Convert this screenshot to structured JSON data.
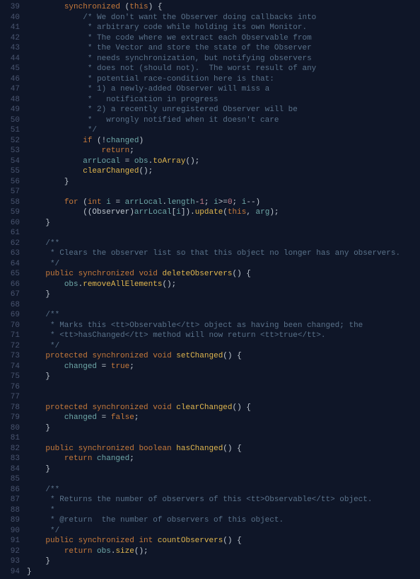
{
  "lines": [
    {
      "n": 39,
      "indent": 8,
      "t": [
        {
          "c": "kw",
          "s": "synchronized"
        },
        {
          "c": "pl",
          "s": " ("
        },
        {
          "c": "kw",
          "s": "this"
        },
        {
          "c": "pl",
          "s": ") {"
        }
      ]
    },
    {
      "n": 40,
      "indent": 12,
      "t": [
        {
          "c": "cmt",
          "s": "/* We don't want the Observer doing callbacks into"
        }
      ]
    },
    {
      "n": 41,
      "indent": 12,
      "t": [
        {
          "c": "cmt",
          "s": " * arbitrary code while holding its own Monitor."
        }
      ]
    },
    {
      "n": 42,
      "indent": 12,
      "t": [
        {
          "c": "cmt",
          "s": " * The code where we extract each Observable from"
        }
      ]
    },
    {
      "n": 43,
      "indent": 12,
      "t": [
        {
          "c": "cmt",
          "s": " * the Vector and store the state of the Observer"
        }
      ]
    },
    {
      "n": 44,
      "indent": 12,
      "t": [
        {
          "c": "cmt",
          "s": " * needs synchronization, but notifying observers"
        }
      ]
    },
    {
      "n": 45,
      "indent": 12,
      "t": [
        {
          "c": "cmt",
          "s": " * does not (should not).  The worst result of any"
        }
      ]
    },
    {
      "n": 46,
      "indent": 12,
      "t": [
        {
          "c": "cmt",
          "s": " * potential race-condition here is that:"
        }
      ]
    },
    {
      "n": 47,
      "indent": 12,
      "t": [
        {
          "c": "cmt",
          "s": " * 1) a newly-added Observer will miss a"
        }
      ]
    },
    {
      "n": 48,
      "indent": 12,
      "t": [
        {
          "c": "cmt",
          "s": " *   notification in progress"
        }
      ]
    },
    {
      "n": 49,
      "indent": 12,
      "t": [
        {
          "c": "cmt",
          "s": " * 2) a recently unregistered Observer will be"
        }
      ]
    },
    {
      "n": 50,
      "indent": 12,
      "t": [
        {
          "c": "cmt",
          "s": " *   wrongly notified when it doesn't care"
        }
      ]
    },
    {
      "n": 51,
      "indent": 12,
      "t": [
        {
          "c": "cmt",
          "s": " */"
        }
      ]
    },
    {
      "n": 52,
      "indent": 12,
      "t": [
        {
          "c": "kw",
          "s": "if"
        },
        {
          "c": "pl",
          "s": " (!"
        },
        {
          "c": "var",
          "s": "changed"
        },
        {
          "c": "pl",
          "s": ")"
        }
      ]
    },
    {
      "n": 53,
      "indent": 16,
      "t": [
        {
          "c": "kw",
          "s": "return"
        },
        {
          "c": "pl",
          "s": ";"
        }
      ]
    },
    {
      "n": 54,
      "indent": 12,
      "t": [
        {
          "c": "var",
          "s": "arrLocal"
        },
        {
          "c": "pl",
          "s": " = "
        },
        {
          "c": "var",
          "s": "obs"
        },
        {
          "c": "pl",
          "s": "."
        },
        {
          "c": "fn",
          "s": "toArray"
        },
        {
          "c": "pl",
          "s": "();"
        }
      ]
    },
    {
      "n": 55,
      "indent": 12,
      "t": [
        {
          "c": "fn",
          "s": "clearChanged"
        },
        {
          "c": "pl",
          "s": "();"
        }
      ]
    },
    {
      "n": 56,
      "indent": 8,
      "t": [
        {
          "c": "pl",
          "s": "}"
        }
      ]
    },
    {
      "n": 57,
      "indent": 0,
      "t": []
    },
    {
      "n": 58,
      "indent": 8,
      "t": [
        {
          "c": "kw",
          "s": "for"
        },
        {
          "c": "pl",
          "s": " ("
        },
        {
          "c": "kw",
          "s": "int"
        },
        {
          "c": "pl",
          "s": " "
        },
        {
          "c": "var",
          "s": "i"
        },
        {
          "c": "pl",
          "s": " = "
        },
        {
          "c": "var",
          "s": "arrLocal"
        },
        {
          "c": "pl",
          "s": "."
        },
        {
          "c": "var",
          "s": "length"
        },
        {
          "c": "pl",
          "s": "-"
        },
        {
          "c": "num",
          "s": "1"
        },
        {
          "c": "pl",
          "s": "; "
        },
        {
          "c": "var",
          "s": "i"
        },
        {
          "c": "pl",
          "s": ">="
        },
        {
          "c": "num",
          "s": "0"
        },
        {
          "c": "pl",
          "s": "; "
        },
        {
          "c": "var",
          "s": "i"
        },
        {
          "c": "pl",
          "s": "--)"
        }
      ]
    },
    {
      "n": 59,
      "indent": 12,
      "t": [
        {
          "c": "pl",
          "s": "(("
        },
        {
          "c": "type",
          "s": "Observer"
        },
        {
          "c": "pl",
          "s": ")"
        },
        {
          "c": "var",
          "s": "arrLocal"
        },
        {
          "c": "pl",
          "s": "["
        },
        {
          "c": "var",
          "s": "i"
        },
        {
          "c": "pl",
          "s": "])."
        },
        {
          "c": "fn",
          "s": "update"
        },
        {
          "c": "pl",
          "s": "("
        },
        {
          "c": "kw",
          "s": "this"
        },
        {
          "c": "pl",
          "s": ", "
        },
        {
          "c": "var",
          "s": "arg"
        },
        {
          "c": "pl",
          "s": ");"
        }
      ]
    },
    {
      "n": 60,
      "indent": 4,
      "t": [
        {
          "c": "pl",
          "s": "}"
        }
      ]
    },
    {
      "n": 61,
      "indent": 0,
      "t": []
    },
    {
      "n": 62,
      "indent": 4,
      "t": [
        {
          "c": "cmt",
          "s": "/**"
        }
      ]
    },
    {
      "n": 63,
      "indent": 4,
      "t": [
        {
          "c": "cmt",
          "s": " * Clears the observer list so that this object no longer has any observers."
        }
      ]
    },
    {
      "n": 64,
      "indent": 4,
      "t": [
        {
          "c": "cmt",
          "s": " */"
        }
      ]
    },
    {
      "n": 65,
      "indent": 4,
      "t": [
        {
          "c": "kw",
          "s": "public"
        },
        {
          "c": "pl",
          "s": " "
        },
        {
          "c": "kw",
          "s": "synchronized"
        },
        {
          "c": "pl",
          "s": " "
        },
        {
          "c": "kw",
          "s": "void"
        },
        {
          "c": "pl",
          "s": " "
        },
        {
          "c": "fn",
          "s": "deleteObservers"
        },
        {
          "c": "pl",
          "s": "() {"
        }
      ]
    },
    {
      "n": 66,
      "indent": 8,
      "t": [
        {
          "c": "var",
          "s": "obs"
        },
        {
          "c": "pl",
          "s": "."
        },
        {
          "c": "fn",
          "s": "removeAllElements"
        },
        {
          "c": "pl",
          "s": "();"
        }
      ]
    },
    {
      "n": 67,
      "indent": 4,
      "t": [
        {
          "c": "pl",
          "s": "}"
        }
      ]
    },
    {
      "n": 68,
      "indent": 0,
      "t": []
    },
    {
      "n": 69,
      "indent": 4,
      "t": [
        {
          "c": "cmt",
          "s": "/**"
        }
      ]
    },
    {
      "n": 70,
      "indent": 4,
      "t": [
        {
          "c": "cmt",
          "s": " * Marks this <tt>Observable</tt> object as having been changed; the"
        }
      ]
    },
    {
      "n": 71,
      "indent": 4,
      "t": [
        {
          "c": "cmt",
          "s": " * <tt>hasChanged</tt> method will now return <tt>true</tt>."
        }
      ]
    },
    {
      "n": 72,
      "indent": 4,
      "t": [
        {
          "c": "cmt",
          "s": " */"
        }
      ]
    },
    {
      "n": 73,
      "indent": 4,
      "t": [
        {
          "c": "kw",
          "s": "protected"
        },
        {
          "c": "pl",
          "s": " "
        },
        {
          "c": "kw",
          "s": "synchronized"
        },
        {
          "c": "pl",
          "s": " "
        },
        {
          "c": "kw",
          "s": "void"
        },
        {
          "c": "pl",
          "s": " "
        },
        {
          "c": "fn",
          "s": "setChanged"
        },
        {
          "c": "pl",
          "s": "() {"
        }
      ]
    },
    {
      "n": 74,
      "indent": 8,
      "t": [
        {
          "c": "var",
          "s": "changed"
        },
        {
          "c": "pl",
          "s": " = "
        },
        {
          "c": "kw",
          "s": "true"
        },
        {
          "c": "pl",
          "s": ";"
        }
      ]
    },
    {
      "n": 75,
      "indent": 4,
      "t": [
        {
          "c": "pl",
          "s": "}"
        }
      ]
    },
    {
      "n": 76,
      "indent": 0,
      "t": []
    },
    {
      "n": 77,
      "indent": 0,
      "t": []
    },
    {
      "n": 78,
      "indent": 4,
      "t": [
        {
          "c": "kw",
          "s": "protected"
        },
        {
          "c": "pl",
          "s": " "
        },
        {
          "c": "kw",
          "s": "synchronized"
        },
        {
          "c": "pl",
          "s": " "
        },
        {
          "c": "kw",
          "s": "void"
        },
        {
          "c": "pl",
          "s": " "
        },
        {
          "c": "fn",
          "s": "clearChanged"
        },
        {
          "c": "pl",
          "s": "() {"
        }
      ]
    },
    {
      "n": 79,
      "indent": 8,
      "t": [
        {
          "c": "var",
          "s": "changed"
        },
        {
          "c": "pl",
          "s": " = "
        },
        {
          "c": "kw",
          "s": "false"
        },
        {
          "c": "pl",
          "s": ";"
        }
      ]
    },
    {
      "n": 80,
      "indent": 4,
      "t": [
        {
          "c": "pl",
          "s": "}"
        }
      ]
    },
    {
      "n": 81,
      "indent": 0,
      "t": []
    },
    {
      "n": 82,
      "indent": 4,
      "t": [
        {
          "c": "kw",
          "s": "public"
        },
        {
          "c": "pl",
          "s": " "
        },
        {
          "c": "kw",
          "s": "synchronized"
        },
        {
          "c": "pl",
          "s": " "
        },
        {
          "c": "kw",
          "s": "boolean"
        },
        {
          "c": "pl",
          "s": " "
        },
        {
          "c": "fn",
          "s": "hasChanged"
        },
        {
          "c": "pl",
          "s": "() {"
        }
      ]
    },
    {
      "n": 83,
      "indent": 8,
      "t": [
        {
          "c": "kw",
          "s": "return"
        },
        {
          "c": "pl",
          "s": " "
        },
        {
          "c": "var",
          "s": "changed"
        },
        {
          "c": "pl",
          "s": ";"
        }
      ]
    },
    {
      "n": 84,
      "indent": 4,
      "t": [
        {
          "c": "pl",
          "s": "}"
        }
      ]
    },
    {
      "n": 85,
      "indent": 0,
      "t": []
    },
    {
      "n": 86,
      "indent": 4,
      "t": [
        {
          "c": "cmt",
          "s": "/**"
        }
      ]
    },
    {
      "n": 87,
      "indent": 4,
      "t": [
        {
          "c": "cmt",
          "s": " * Returns the number of observers of this <tt>Observable</tt> object."
        }
      ]
    },
    {
      "n": 88,
      "indent": 4,
      "t": [
        {
          "c": "cmt",
          "s": " *"
        }
      ]
    },
    {
      "n": 89,
      "indent": 4,
      "t": [
        {
          "c": "cmt",
          "s": " * @return  the number of observers of this object."
        }
      ]
    },
    {
      "n": 90,
      "indent": 4,
      "t": [
        {
          "c": "cmt",
          "s": " */"
        }
      ]
    },
    {
      "n": 91,
      "indent": 4,
      "t": [
        {
          "c": "kw",
          "s": "public"
        },
        {
          "c": "pl",
          "s": " "
        },
        {
          "c": "kw",
          "s": "synchronized"
        },
        {
          "c": "pl",
          "s": " "
        },
        {
          "c": "kw",
          "s": "int"
        },
        {
          "c": "pl",
          "s": " "
        },
        {
          "c": "fn",
          "s": "countObservers"
        },
        {
          "c": "pl",
          "s": "() {"
        }
      ]
    },
    {
      "n": 92,
      "indent": 8,
      "t": [
        {
          "c": "kw",
          "s": "return"
        },
        {
          "c": "pl",
          "s": " "
        },
        {
          "c": "var",
          "s": "obs"
        },
        {
          "c": "pl",
          "s": "."
        },
        {
          "c": "fn",
          "s": "size"
        },
        {
          "c": "pl",
          "s": "();"
        }
      ]
    },
    {
      "n": 93,
      "indent": 4,
      "t": [
        {
          "c": "pl",
          "s": "}"
        }
      ]
    },
    {
      "n": 94,
      "indent": 0,
      "t": [
        {
          "c": "pl",
          "s": "}"
        }
      ]
    }
  ]
}
